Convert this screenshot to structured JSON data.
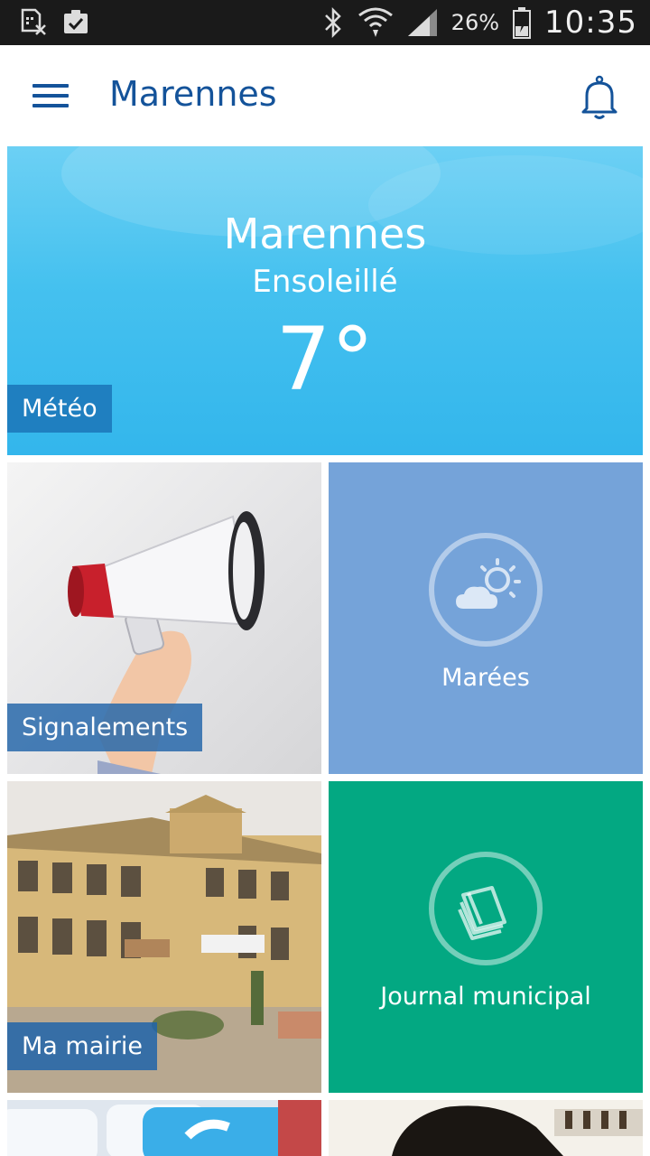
{
  "status_bar": {
    "battery_percent": "26%",
    "time": "10:35"
  },
  "app_bar": {
    "title": "Marennes"
  },
  "weather": {
    "city": "Marennes",
    "condition": "Ensoleillé",
    "temperature": "7°",
    "label": "Météo"
  },
  "tiles": {
    "signalements": {
      "label": "Signalements"
    },
    "marees": {
      "label": "Marées"
    },
    "mairie": {
      "label": "Ma mairie"
    },
    "journal": {
      "label": "Journal municipal"
    }
  },
  "colors": {
    "brand_blue": "#14539a",
    "weather_blue": "#33b6ec",
    "marees_blue": "#75a3d9",
    "journal_green": "#03a882"
  }
}
